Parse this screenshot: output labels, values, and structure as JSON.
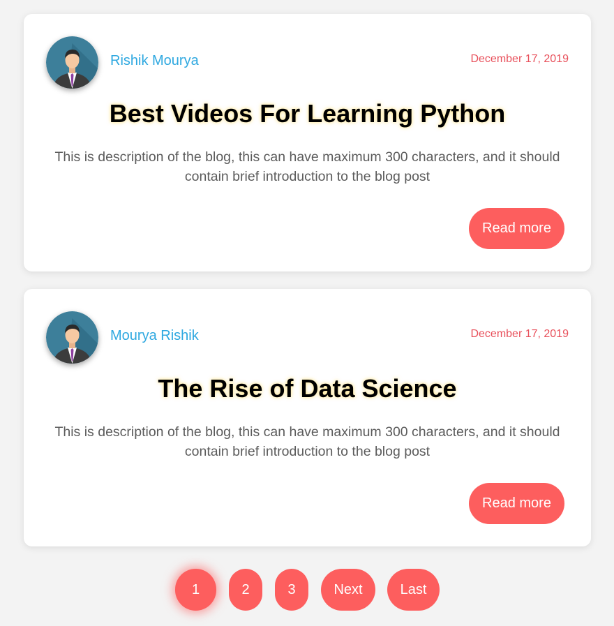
{
  "posts": [
    {
      "author": "Rishik Mourya",
      "date": "December 17, 2019",
      "title": "Best Videos For Learning Python",
      "description": "This is description of the blog, this can have maximum 300 characters, and it should contain brief introduction to the blog post",
      "read_more_label": "Read more",
      "avatar_icon": "user-avatar-icon"
    },
    {
      "author": "Mourya Rishik",
      "date": "December 17, 2019",
      "title": "The Rise of Data Science",
      "description": "This is description of the blog, this can have maximum 300 characters, and it should contain brief introduction to the blog post",
      "read_more_label": "Read more",
      "avatar_icon": "user-avatar-icon"
    }
  ],
  "pagination": {
    "pages": [
      "1",
      "2",
      "3"
    ],
    "current_page": "1",
    "next_label": "Next",
    "last_label": "Last"
  },
  "colors": {
    "accent": "#fd5e5e",
    "author_link": "#2ea8e0",
    "date": "#e8505b",
    "background": "#f3f3f3"
  }
}
